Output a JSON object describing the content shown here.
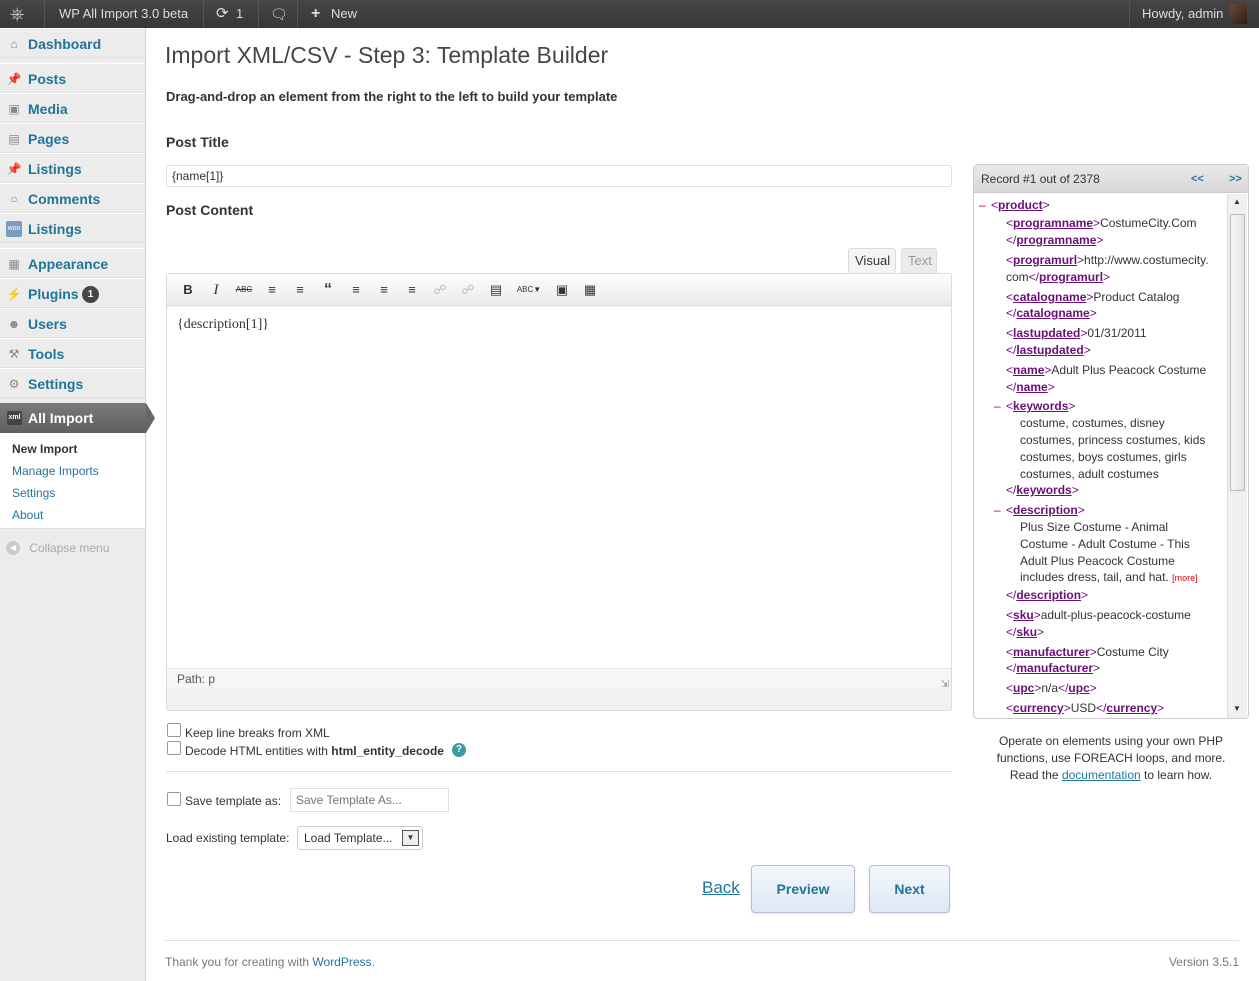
{
  "adminbar": {
    "site": "WP All Import 3.0 beta",
    "updates": "1",
    "new_label": "New",
    "howdy": "Howdy, admin"
  },
  "sidebar": {
    "items": [
      {
        "label": "Dashboard",
        "icon": "dashboard-icon"
      },
      {
        "label": "Posts",
        "icon": "pin-icon"
      },
      {
        "label": "Media",
        "icon": "media-icon"
      },
      {
        "label": "Pages",
        "icon": "pages-icon"
      },
      {
        "label": "Listings",
        "icon": "pin-icon"
      },
      {
        "label": "Comments",
        "icon": "comment-icon"
      },
      {
        "label": "Listings",
        "icon": "woo-icon"
      },
      {
        "label": "Appearance",
        "icon": "appearance-icon"
      },
      {
        "label": "Plugins",
        "icon": "plugins-icon",
        "badge": "1"
      },
      {
        "label": "Users",
        "icon": "users-icon"
      },
      {
        "label": "Tools",
        "icon": "tools-icon"
      },
      {
        "label": "Settings",
        "icon": "settings-icon"
      }
    ],
    "active": {
      "label": "All Import",
      "icon": "xml-icon"
    },
    "submenu": [
      "New Import",
      "Manage Imports",
      "Settings",
      "About"
    ],
    "collapse": "Collapse menu"
  },
  "page": {
    "title": "Import XML/CSV - Step 3: Template Builder",
    "subtitle": "Drag-and-drop an element from the right to the left to build your template",
    "post_title_label": "Post Title",
    "post_title_value": "{name[1]}",
    "post_content_label": "Post Content",
    "tab_visual": "Visual",
    "tab_text": "Text",
    "content": "{description[1]}",
    "path": "Path: p",
    "keep_linebreaks": "Keep line breaks from XML",
    "decode_html_prefix": "Decode HTML entities with ",
    "decode_html_fn": "html_entity_decode",
    "save_template_label": "Save template as:",
    "save_template_placeholder": "Save Template As...",
    "load_template_label": "Load existing template:",
    "load_template_value": "Load Template...",
    "back": "Back",
    "preview": "Preview",
    "next": "Next"
  },
  "xml": {
    "record": "Record #1 out of 2378",
    "prev": "<<",
    "next": ">>",
    "more": "[more]",
    "notes_line1": "Operate on elements using your own PHP",
    "notes_line2": "functions, use FOREACH loops, and more.",
    "notes_line3_prefix": "Read the ",
    "notes_link": "documentation",
    "notes_line3_suffix": " to learn how."
  },
  "footer": {
    "thanks": "Thank you for creating with ",
    "wp": "WordPress",
    "thanks_end": ".",
    "version": "Version 3.5.1"
  },
  "colors": {
    "link": "#21759b",
    "tag": "#6a0f77",
    "adminbar": "#464646"
  }
}
